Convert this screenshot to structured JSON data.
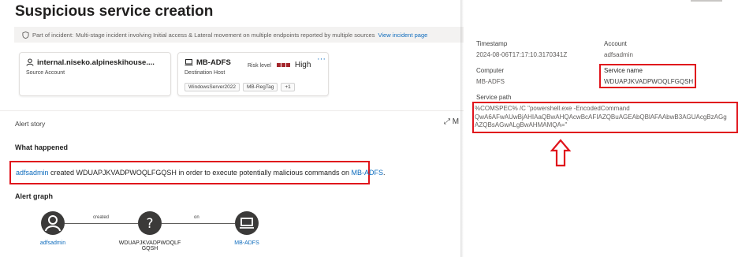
{
  "page": {
    "title": "Suspicious service creation",
    "banner": {
      "prefix": "Part of incident:",
      "text": "Multi-stage incident involving Initial access & Lateral movement on multiple endpoints reported by multiple sources",
      "link": "View incident page"
    }
  },
  "cards": {
    "source": {
      "name": "internal.niseko.alpineskihouse....",
      "role": "Source Account"
    },
    "dest": {
      "name": "MB-ADFS",
      "role": "Destination Host",
      "risk_label": "Risk level",
      "risk_value": "High",
      "tags": [
        "WindowsServer2022",
        "MB-RegTag",
        "+1"
      ]
    }
  },
  "story": {
    "title": "Alert story",
    "expand_label": "M"
  },
  "what_happened": {
    "title": "What happened",
    "actor": "adfsadmin",
    "middle": " created WDUAPJKVADPWOQLFGQSH in order to execute potentially malicious commands on ",
    "target": "MB-ADFS",
    "end": "."
  },
  "graph": {
    "title": "Alert graph",
    "edge1": "created",
    "edge2": "on",
    "node1": "adfsadmin",
    "node2_line1": "WDUAPJKVADPWOQLF",
    "node2_line2": "GQSH",
    "node3": "MB-ADFS"
  },
  "details": {
    "timestamp_label": "Timestamp",
    "timestamp": "2024-08-06T17:17:10.3170341Z",
    "account_label": "Account",
    "account": "adfsadmin",
    "computer_label": "Computer",
    "computer": "MB-ADFS",
    "service_name_label": "Service name",
    "service_name": "WDUAPJKVADPWOQLFGQSH",
    "service_path_label": "Service path",
    "service_path_line1": "%COMSPEC% /C \"powershell.exe -EncodedCommand",
    "service_path_line2": "QwA6AFwAUwBjAHIAaQBwAHQAcwBcAFIAZQBuAGEAbQBlAFAAbwB3AGUAcgBzAGg",
    "service_path_line3": "AZQBsAGwALgBwAHMAMQA=\""
  },
  "colors": {
    "highlight": "#e0141c",
    "link": "#0f6cbd",
    "risk_high": "#a4262c"
  }
}
